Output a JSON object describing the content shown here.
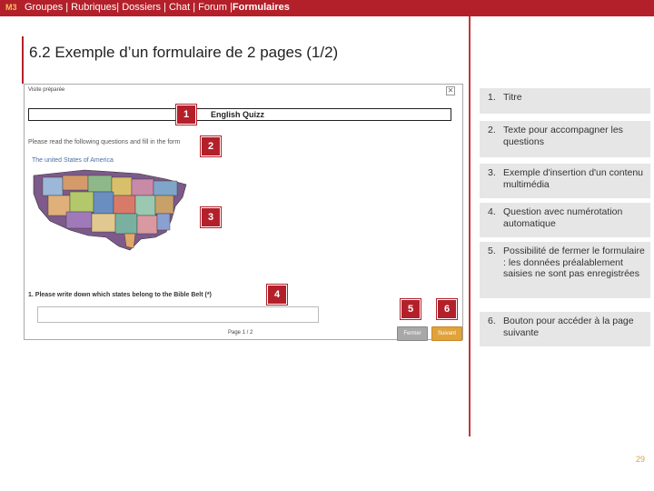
{
  "header": {
    "logo": "M3",
    "nav_prefix": "Groupes | Rubriques| Dossiers | Chat | Forum |",
    "nav_active": "Formulaires"
  },
  "title": "6.2 Exemple d’un formulaire de 2 pages (1/2)",
  "screenshot": {
    "window_title": "Visite préparée",
    "close_glyph": "✕",
    "quiz_title": "English Quizz",
    "intro_text": "Please read the following questions and fill in the form",
    "map_caption": "The united States of America",
    "question": "1. Please write down which states belong to the Bible Belt (*)",
    "page_indicator": "Page 1 / 2",
    "close_button": "Fermer",
    "next_button": "Suivant"
  },
  "markers": [
    "1",
    "2",
    "3",
    "4",
    "5",
    "6"
  ],
  "legend": [
    {
      "num": "1.",
      "text": "Titre"
    },
    {
      "num": "2.",
      "text": "Texte pour accompagner les questions"
    },
    {
      "num": "3.",
      "text": "Exemple d'insertion d'un contenu multimédia"
    },
    {
      "num": "4.",
      "text": "Question avec numérotation automatique"
    },
    {
      "num": "5.",
      "text": "Possibilité de fermer le formulaire : les données préalablement saisies ne sont pas enregistrées"
    },
    {
      "num": "6.",
      "text": "Bouton pour accéder à la page suivante"
    }
  ],
  "page_number": "29",
  "colors": {
    "brand_red": "#b3202a",
    "page_number_gold": "#d8a23a",
    "legend_bg": "#e6e6e6",
    "next_button": "#e0a33a",
    "close_button": "#a8a8a8"
  }
}
